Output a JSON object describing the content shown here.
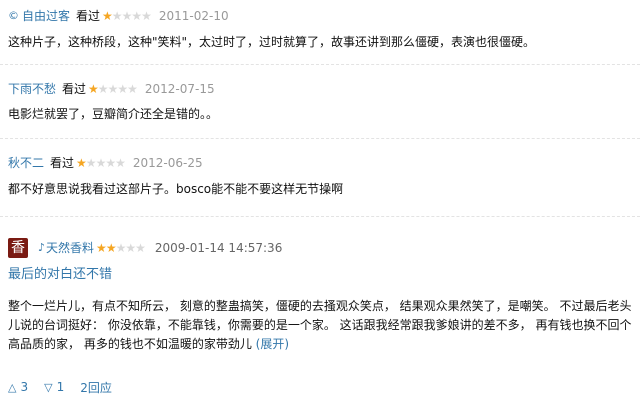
{
  "comments": [
    {
      "user": "自由过客",
      "verb": "看过",
      "stars": 1,
      "date": "2011-02-10",
      "text": "这种片子，这种桥段，这种\"笑料\"，太过时了，过时就算了，故事还讲到那么僵硬，表演也很僵硬。"
    },
    {
      "user": "下雨不愁",
      "verb": "看过",
      "stars": 1,
      "date": "2012-07-15",
      "text": "电影烂就罢了，豆瓣简介还全是错的。。"
    },
    {
      "user": "秋不二",
      "verb": "看过",
      "stars": 1,
      "date": "2012-06-25",
      "text": "都不好意思说我看过这部片子。bosco能不能不要这样无节操啊"
    }
  ],
  "review": {
    "avatar_char": "香",
    "user": "天然香料",
    "stars": 2,
    "date": "2009-01-14 14:57:36",
    "title": "最后的对白还不错",
    "body": "整个一烂片儿，有点不知所云，  刻意的整蛊搞笑，僵硬的去搔观众笑点，  结果观众果然笑了，是嘲笑。  不过最后老头儿说的台词挺好：  你没依靠，不能靠钱，你需要的是一个家。  这话跟我经常跟我爹娘讲的差不多，  再有钱也换不回个高品质的家，  再多的钱也不如温暖的家带劲儿 ",
    "expand_label": "(展开)",
    "useful_count": "3",
    "useless_count": "1",
    "reply_label": "2回应"
  },
  "colors": {
    "link": "#3377aa",
    "star_on": "#f5a623",
    "star_off": "#d9d9d9",
    "date": "#999999"
  }
}
